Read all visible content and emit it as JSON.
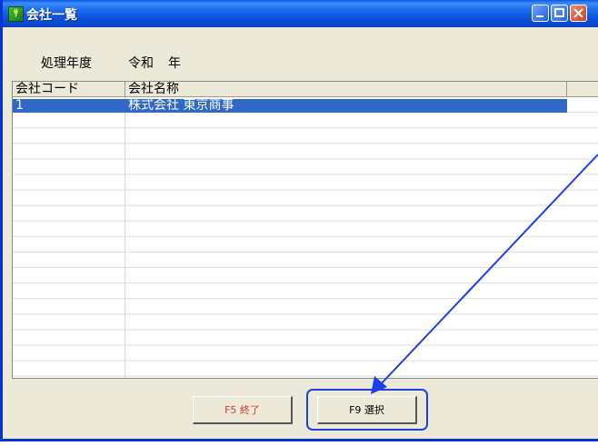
{
  "window": {
    "title": "会社一覧",
    "app_icon": "app-icon"
  },
  "fiscal_year": {
    "label": "処理年度",
    "era": "令和",
    "unit": "年"
  },
  "table": {
    "columns": [
      "会社コード",
      "会社名称"
    ],
    "rows": [
      {
        "code": "1",
        "name": "株式会社 東京商事",
        "selected": true
      }
    ]
  },
  "buttons": {
    "exit_label": "F5  終了",
    "select_label": "F9  選択"
  },
  "colors": {
    "selection": "#2f68c7",
    "exit_text": "#d23b2a",
    "annotation": "#1d40e8"
  }
}
